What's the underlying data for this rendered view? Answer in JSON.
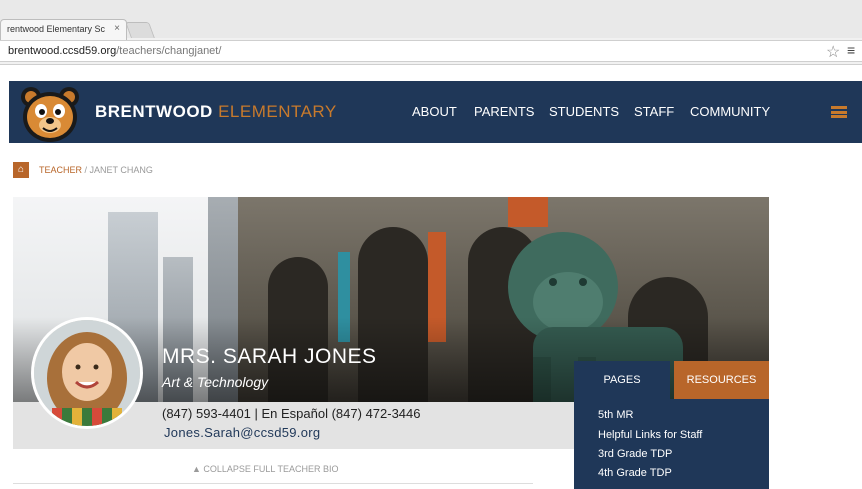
{
  "browser": {
    "tab_title": "rentwood Elementary Sc",
    "tab_close": "×",
    "url_host": "brentwood.ccsd59.org",
    "url_path": "/teachers/changjanet/"
  },
  "header": {
    "brand_primary": "BRENTWOOD",
    "brand_accent": "ELEMENTARY",
    "nav": [
      "ABOUT",
      "PARENTS",
      "STUDENTS",
      "STAFF",
      "COMMUNITY"
    ]
  },
  "breadcrumb": {
    "link": "TEACHER",
    "separator": " / ",
    "current": "JANET CHANG"
  },
  "teacher": {
    "name": "MRS. SARAH JONES",
    "subject": "Art & Technology",
    "phone": "(847) 593-4401 | En Español (847) 472-3446",
    "email": "Jones.Sarah@ccsd59.org"
  },
  "collapse_label": "▲   COLLAPSE FULL TEACHER BIO",
  "panel": {
    "tab_pages": "PAGES",
    "tab_resources": "RESOURCES",
    "links": [
      "5th MR",
      "Helpful Links for Staff",
      "3rd Grade TDP",
      "4th Grade TDP"
    ]
  },
  "colors": {
    "navy": "#1f3758",
    "accent": "#c87a2c",
    "rust": "#b8662a"
  },
  "icons": {
    "home": "home-icon",
    "star": "star-icon",
    "menu": "browser-menu-icon",
    "hamburger": "hamburger-icon",
    "logo": "bear-logo-icon"
  }
}
